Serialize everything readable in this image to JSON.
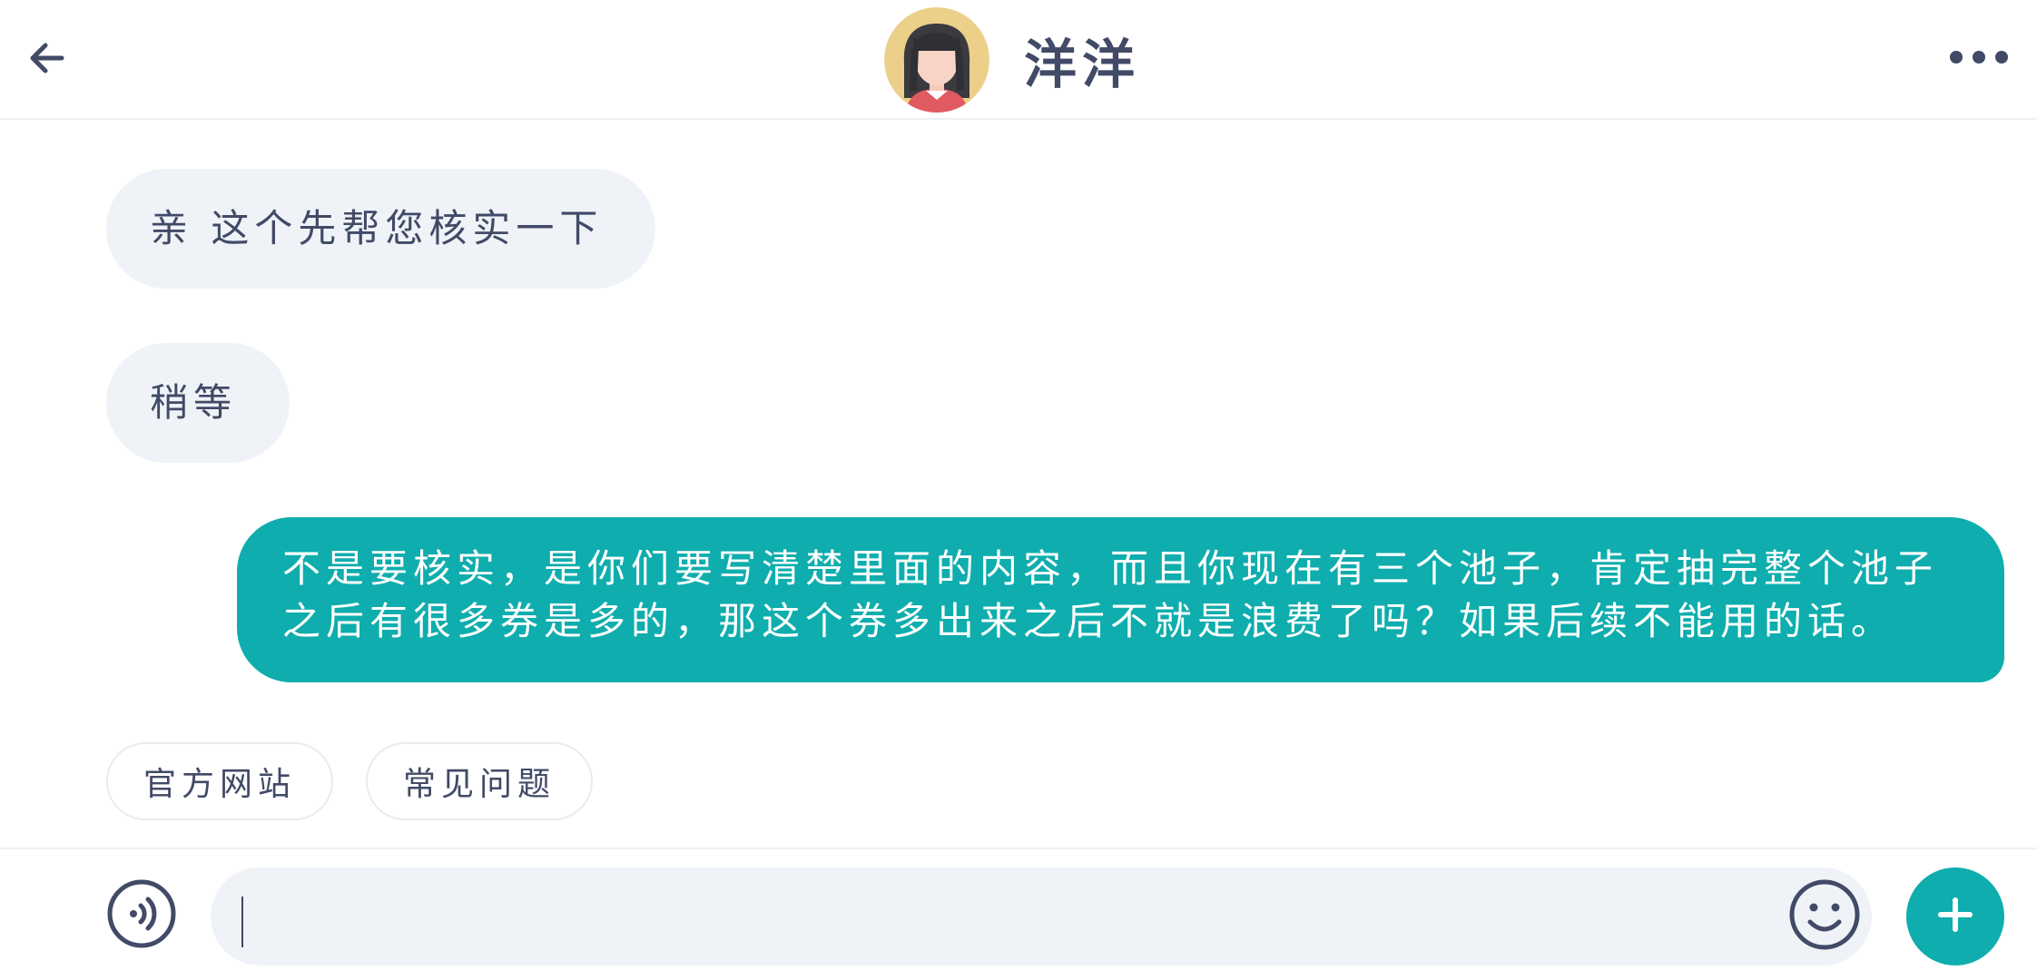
{
  "header": {
    "title": "洋洋",
    "back_icon": "arrow-left-icon",
    "more_icon": "more-dots-icon",
    "avatar_icon": "girl-avatar"
  },
  "messages": [
    {
      "side": "left",
      "text": "亲 这个先帮您核实一下"
    },
    {
      "side": "left",
      "text": "稍等"
    },
    {
      "side": "right",
      "text": "不是要核实，是你们要写清楚里面的内容，而且你现在有三个池子，肯定抽完整个池子之后有很多券是多的，那这个券多出来之后不就是浪费了吗？如果后续不能用的话。"
    }
  ],
  "quick_replies": [
    {
      "label": "官方网站"
    },
    {
      "label": "常见问题"
    }
  ],
  "input": {
    "value": "",
    "voice_icon": "voice-icon",
    "emoji_icon": "smiley-icon",
    "plus_icon": "plus-icon"
  },
  "colors": {
    "accent": "#0fadad",
    "bubble_left": "#eff3f7",
    "text_primary": "#414a66"
  }
}
